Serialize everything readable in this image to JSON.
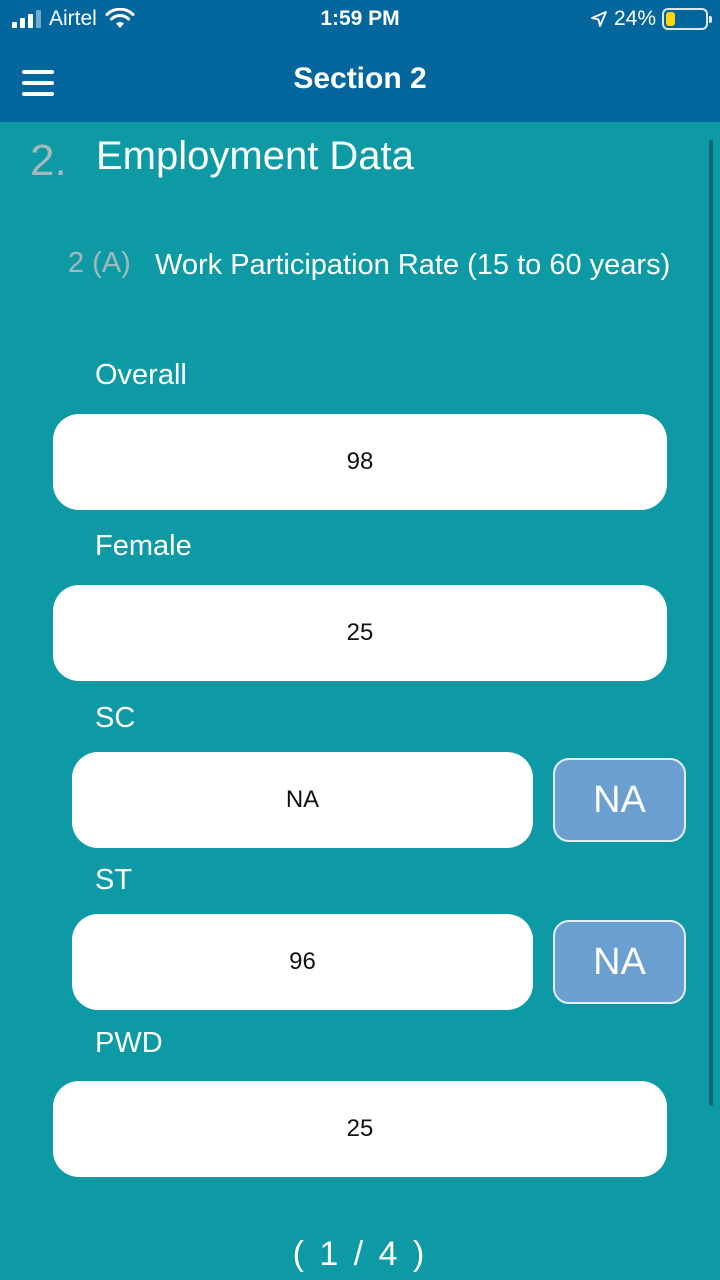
{
  "status_bar": {
    "carrier": "Airtel",
    "time": "1:59 PM",
    "battery_percent": "24%",
    "battery_level": 0.24
  },
  "nav": {
    "title": "Section 2",
    "menu_icon": "hamburger-menu-icon"
  },
  "section": {
    "number": "2.",
    "title": "Employment Data"
  },
  "question": {
    "number": "2 (A)",
    "text": "Work Participation Rate (15 to 60 years)"
  },
  "fields": {
    "overall": {
      "label": "Overall",
      "value": "98"
    },
    "female": {
      "label": "Female",
      "value": "25"
    },
    "sc": {
      "label": "SC",
      "value": "NA",
      "na_button": "NA"
    },
    "st": {
      "label": "ST",
      "value": "96",
      "na_button": "NA"
    },
    "pwd": {
      "label": "PWD",
      "value": "25"
    }
  },
  "pager": {
    "text": "( 1 / 4 )"
  },
  "colors": {
    "header": "#03679e",
    "background": "#0d9aa5",
    "na_button": "#6a9fd0"
  }
}
